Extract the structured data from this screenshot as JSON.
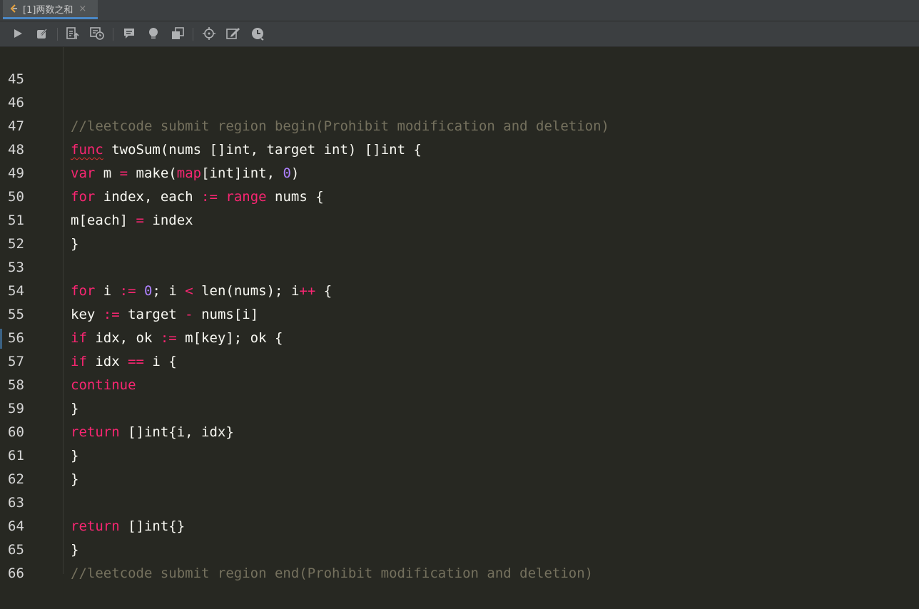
{
  "tab": {
    "title": "[1]两数之和",
    "close": "×"
  },
  "toolbar": {
    "icons": [
      "run-icon",
      "edit-icon",
      "submit-icon",
      "test-cases-icon",
      "comment-icon",
      "hint-icon",
      "solution-icon",
      "locate-icon",
      "note-icon",
      "timer-icon"
    ]
  },
  "colors": {
    "background": "#272822",
    "keyword": "#f92672",
    "number": "#ae81ff",
    "comment": "#75715e",
    "text": "#f8f8f2",
    "line_number": "#d6d6d6"
  },
  "editor": {
    "lines": [
      {
        "n": "45",
        "t": {}
      },
      {
        "n": "46",
        "t": {
          "a": "//leetcode submit region begin(Prohibit modification and deletion)"
        }
      },
      {
        "n": "47",
        "t": {
          "a": "func",
          "b": " twoSum(nums []int, target int) []int {"
        }
      },
      {
        "n": "48",
        "t": {
          "a": "var",
          "b": " m ",
          "c": "=",
          "d": " make(",
          "e": "map",
          "f": "[int]int, ",
          "g": "0",
          "h": ")"
        }
      },
      {
        "n": "49",
        "t": {
          "a": "for",
          "b": " index, each ",
          "c": ":=",
          "d": " ",
          "e": "range",
          "f": " nums {"
        }
      },
      {
        "n": "50",
        "t": {
          "a": "m[each] ",
          "b": "=",
          "c": " index"
        }
      },
      {
        "n": "51",
        "t": {
          "a": "}"
        }
      },
      {
        "n": "52",
        "t": {}
      },
      {
        "n": "53",
        "t": {
          "a": "for",
          "b": " i ",
          "c": ":=",
          "d": " ",
          "e": "0",
          "f": "; i ",
          "g": "<",
          "h": " len(nums); i",
          "i": "++",
          "j": " {"
        }
      },
      {
        "n": "54",
        "t": {
          "a": "key ",
          "b": ":=",
          "c": " target ",
          "d": "-",
          "e": " nums[i]"
        }
      },
      {
        "n": "55",
        "t": {
          "a": "if",
          "b": " idx, ok ",
          "c": ":=",
          "d": " m[key]; ok {"
        }
      },
      {
        "n": "56",
        "t": {
          "a": "if",
          "b": " idx ",
          "c": "==",
          "d": " i {"
        }
      },
      {
        "n": "57",
        "t": {
          "a": "continue"
        }
      },
      {
        "n": "58",
        "t": {
          "a": "}"
        }
      },
      {
        "n": "59",
        "t": {
          "a": "return",
          "b": " []int{i, idx}"
        }
      },
      {
        "n": "60",
        "t": {
          "a": "}"
        }
      },
      {
        "n": "61",
        "t": {
          "a": "}"
        }
      },
      {
        "n": "62",
        "t": {}
      },
      {
        "n": "63",
        "t": {
          "a": "return",
          "b": " []int{}"
        }
      },
      {
        "n": "64",
        "t": {
          "a": "}"
        }
      },
      {
        "n": "65",
        "t": {
          "a": "//leetcode submit region end(Prohibit modification and deletion)"
        }
      },
      {
        "n": "66",
        "t": {}
      }
    ]
  }
}
